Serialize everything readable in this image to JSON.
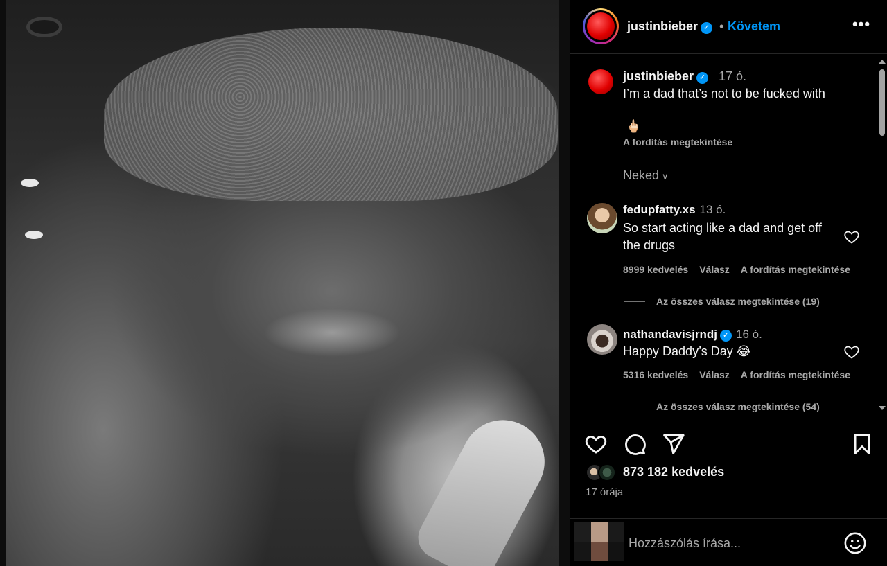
{
  "post": {
    "author": "justinbieber",
    "follow_label": "Követem",
    "separator": "•",
    "more_label": "•••"
  },
  "caption": {
    "author": "justinbieber",
    "time": "17 ó.",
    "text": "I’m a dad that’s not to be fucked with",
    "emoji": "🖕🏻",
    "translate_label": "A fordítás megtekintése"
  },
  "sort": {
    "label": "Neked",
    "chevron": "∨"
  },
  "comments": [
    {
      "username": "fedupfatty.xs",
      "time": "13 ó.",
      "text": "So start acting like a dad and get off the drugs",
      "likes": "8999 kedvelés",
      "reply": "Válasz",
      "translate": "A fordítás megtekintése",
      "replies": "Az összes válasz megtekintése (19)"
    },
    {
      "username": "nathandavisjrndj",
      "time": "16 ó.",
      "text": "Happy Daddy’s Day 😂",
      "likes": "5316 kedvelés",
      "reply": "Válasz",
      "translate": "A fordítás megtekintése",
      "replies": "Az összes válasz megtekintése (54)"
    }
  ],
  "actions": {
    "likes_count": "873 182 kedvelés",
    "age": "17 órája"
  },
  "comment_input": {
    "placeholder": "Hozzászólás írása..."
  },
  "colors": {
    "accent": "#0095f6",
    "background": "#000000",
    "muted_text": "#a8a8a8",
    "divider": "#262626"
  }
}
